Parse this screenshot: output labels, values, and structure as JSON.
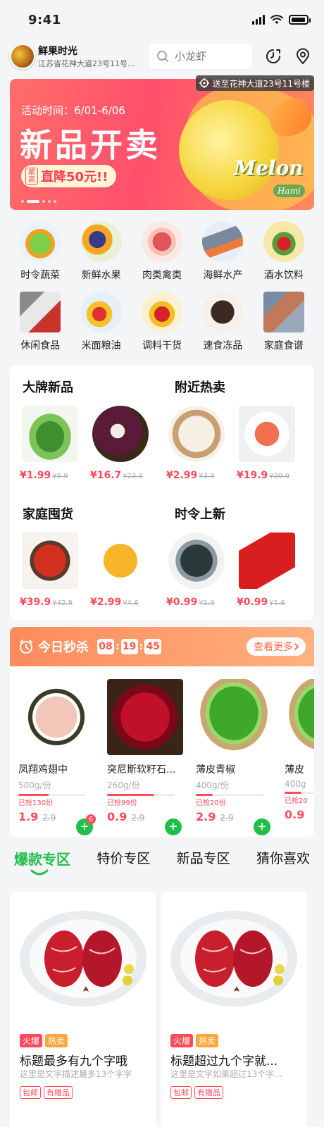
{
  "status": {
    "time": "9:41"
  },
  "header": {
    "shop_name": "鲜果时光",
    "shop_address": "江苏省花神大道23号11号...",
    "search_placeholder": "小龙虾",
    "deliver_to": "送至花神大道23号11号楼"
  },
  "banner": {
    "date": "活动时间：6/01-6/06",
    "title": "新品开卖",
    "pill_tag": "最高",
    "pill_text": "直降50元!!",
    "brand": "Melon",
    "brand_sub": "Hami"
  },
  "categories": [
    {
      "label": "时令蔬菜",
      "icon": "vegetable-icon"
    },
    {
      "label": "新鲜水果",
      "icon": "fruit-icon"
    },
    {
      "label": "肉类禽类",
      "icon": "meat-icon"
    },
    {
      "label": "海鲜水产",
      "icon": "seafood-icon"
    },
    {
      "label": "酒水饮料",
      "icon": "drink-icon"
    },
    {
      "label": "休闲食品",
      "icon": "snack-icon"
    },
    {
      "label": "米面粮油",
      "icon": "grain-oil-icon"
    },
    {
      "label": "调料干货",
      "icon": "seasoning-icon"
    },
    {
      "label": "速食冻品",
      "icon": "frozen-food-icon"
    },
    {
      "label": "家庭食谱",
      "icon": "recipe-icon"
    }
  ],
  "sections": [
    {
      "title": "大牌新品",
      "items": [
        {
          "price": "¥1.99",
          "old": "¥5.9"
        },
        {
          "price": "¥16.7",
          "old": "¥23.6"
        }
      ]
    },
    {
      "title": "附近热卖",
      "items": [
        {
          "price": "¥2.99",
          "old": "¥3.9"
        },
        {
          "price": "¥19.9",
          "old": "¥29.9"
        }
      ]
    },
    {
      "title": "家庭囤货",
      "items": [
        {
          "price": "¥39.9",
          "old": "¥42.9"
        },
        {
          "price": "¥2.99",
          "old": "¥4.6"
        }
      ]
    },
    {
      "title": "时令上新",
      "items": [
        {
          "price": "¥0.99",
          "old": "¥1.9"
        },
        {
          "price": "¥0.99",
          "old": "¥1.6"
        }
      ]
    }
  ],
  "flash": {
    "title": "今日秒杀",
    "timer": [
      "08",
      "19",
      "45"
    ],
    "more": "查看更多",
    "items": [
      {
        "name": "凤翔鸡翅中",
        "spec": "500g/份",
        "sold": "已抢130份",
        "progress": 0.45,
        "price": "1.9",
        "old": "2.9",
        "badge": "6"
      },
      {
        "name": "突尼斯软籽石...",
        "spec": "260g/份",
        "sold": "已抢99份",
        "progress": 0.7,
        "price": "0.9",
        "old": "2.9"
      },
      {
        "name": "薄皮青椒",
        "spec": "400g/份",
        "sold": "已抢20份",
        "progress": 0.25,
        "price": "2.9",
        "old": "2.9"
      },
      {
        "name": "薄皮",
        "spec": "400g",
        "sold": "已抢20",
        "progress": 0.25,
        "price": "0.9",
        "old": ""
      }
    ]
  },
  "tabs": [
    "爆款专区",
    "特价专区",
    "新品专区",
    "猜你喜欢"
  ],
  "products": [
    {
      "tag1": "火爆",
      "tag2": "热卖",
      "title": "标题最多有九个字哦",
      "desc": "这里是文字描述最多13个字字",
      "svc1": "包邮",
      "svc2": "有赠品"
    },
    {
      "tag1": "火爆",
      "tag2": "热卖",
      "title": "标题超过九个字就...",
      "desc": "这里是文字如果超过13个字...",
      "svc1": "包邮",
      "svc2": "有赠品"
    }
  ],
  "colors": {
    "accent": "#1fbf4a",
    "price": "#ff4b5a",
    "banner": "#ff4f6b",
    "flash": "#ff8a5c"
  }
}
